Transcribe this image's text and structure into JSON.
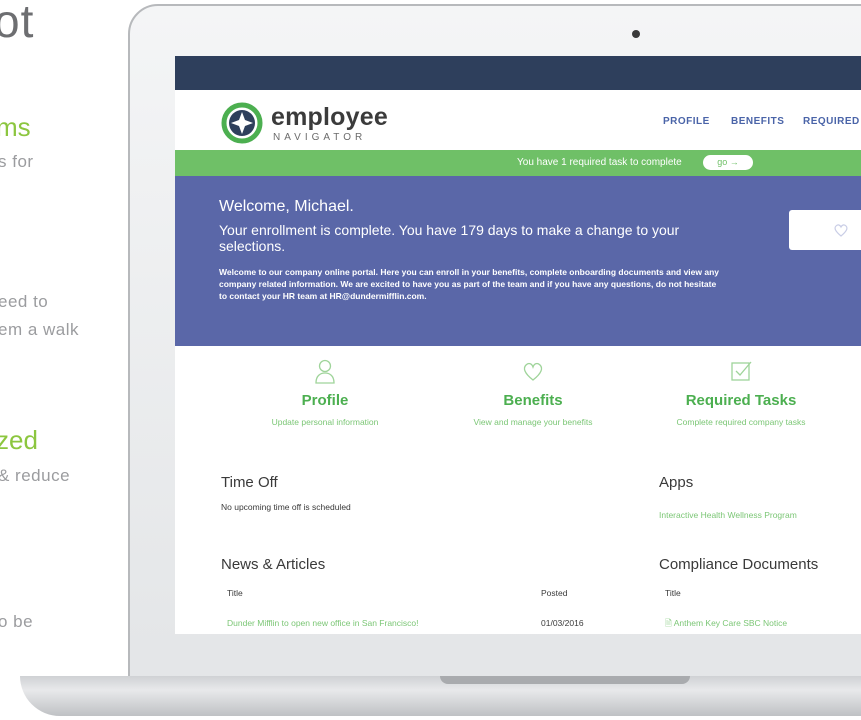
{
  "background_slide": {
    "title_fragment": "ot",
    "line1": "ms",
    "line2": "s for",
    "line3": "eed to",
    "line4": "em a walk",
    "line5": "zed",
    "line6": "& reduce",
    "line7": "o be"
  },
  "header": {
    "logo_word": "employee",
    "logo_sub": "NAVIGATOR",
    "nav": [
      "PROFILE",
      "BENEFITS",
      "REQUIRED T"
    ]
  },
  "task_banner": {
    "text": "You have 1 required task to complete",
    "button_label": "go →"
  },
  "hero": {
    "welcome": "Welcome, Michael.",
    "enrollment": "Your enrollment is complete. You have 179 days to make a change to your selections.",
    "body": "Welcome to our company online portal.  Here you can enroll in your benefits, complete onboarding documents and view any company related information.  We are excited to have you as part of the team and if you have any questions, do not hesitate to contact your HR team at HR@dundermifflin.com."
  },
  "tiles": [
    {
      "title": "Profile",
      "subtitle": "Update personal information",
      "icon": "person-icon"
    },
    {
      "title": "Benefits",
      "subtitle": "View and manage your benefits",
      "icon": "heart-icon"
    },
    {
      "title": "Required Tasks",
      "subtitle": "Complete required company tasks",
      "icon": "checkbox-icon"
    }
  ],
  "time_off": {
    "heading": "Time Off",
    "note": "No upcoming time off is scheduled"
  },
  "apps": {
    "heading": "Apps",
    "link": "Interactive Health Wellness Program"
  },
  "news": {
    "heading": "News & Articles",
    "columns": [
      "Title",
      "Posted"
    ],
    "rows": [
      {
        "title": "Dunder Mifflin to open new office in San Francisco!",
        "posted": "01/03/2016"
      }
    ]
  },
  "compliance": {
    "heading": "Compliance Documents",
    "columns": [
      "Title"
    ],
    "rows": [
      {
        "title": "Anthem Key Care SBC Notice"
      }
    ]
  },
  "colors": {
    "topbar": "#2e3f5c",
    "nav": "#4a64a8",
    "task_banner": "#6fc067",
    "hero": "#5a67a8",
    "accent_green": "#4caf50"
  }
}
